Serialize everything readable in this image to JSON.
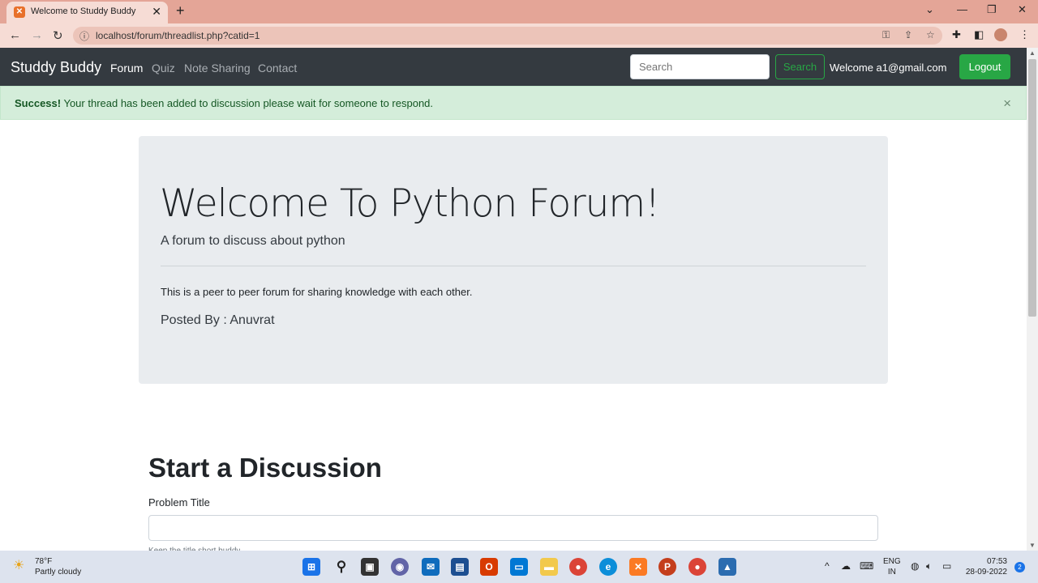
{
  "browser": {
    "tab_title": "Welcome to Studdy Buddy",
    "url": "localhost/forum/threadlist.php?catid=1"
  },
  "navbar": {
    "brand": "Studdy Buddy",
    "links": [
      "Forum",
      "Quiz",
      "Note Sharing",
      "Contact"
    ],
    "search_placeholder": "Search",
    "search_button": "Search",
    "welcome": "Welcome a1@gmail.com",
    "logout": "Logout"
  },
  "alert": {
    "strong": "Success!",
    "message": " Your thread has been added to discussion please wait for someone to respond.",
    "close": "×"
  },
  "jumbotron": {
    "title": "Welcome To Python Forum!",
    "lead": "A forum to discuss about python",
    "description": "This is a peer to peer forum for sharing knowledge with each other.",
    "posted_by": "Posted By : Anuvrat"
  },
  "form": {
    "heading": "Start a Discussion",
    "title_label": "Problem Title",
    "title_help": "Keep the title short buddy"
  },
  "taskbar": {
    "temperature": "78°F",
    "condition": "Partly cloudy",
    "lang_line1": "ENG",
    "lang_line2": "IN",
    "time": "07:53",
    "date": "28-09-2022",
    "notifications": "2"
  },
  "colors": {
    "navbar_bg": "#343a40",
    "success": "#28a745",
    "alert_bg": "#d4edda",
    "jumbotron_bg": "#e9ecef",
    "chrome_tabbar": "#e4a597"
  }
}
